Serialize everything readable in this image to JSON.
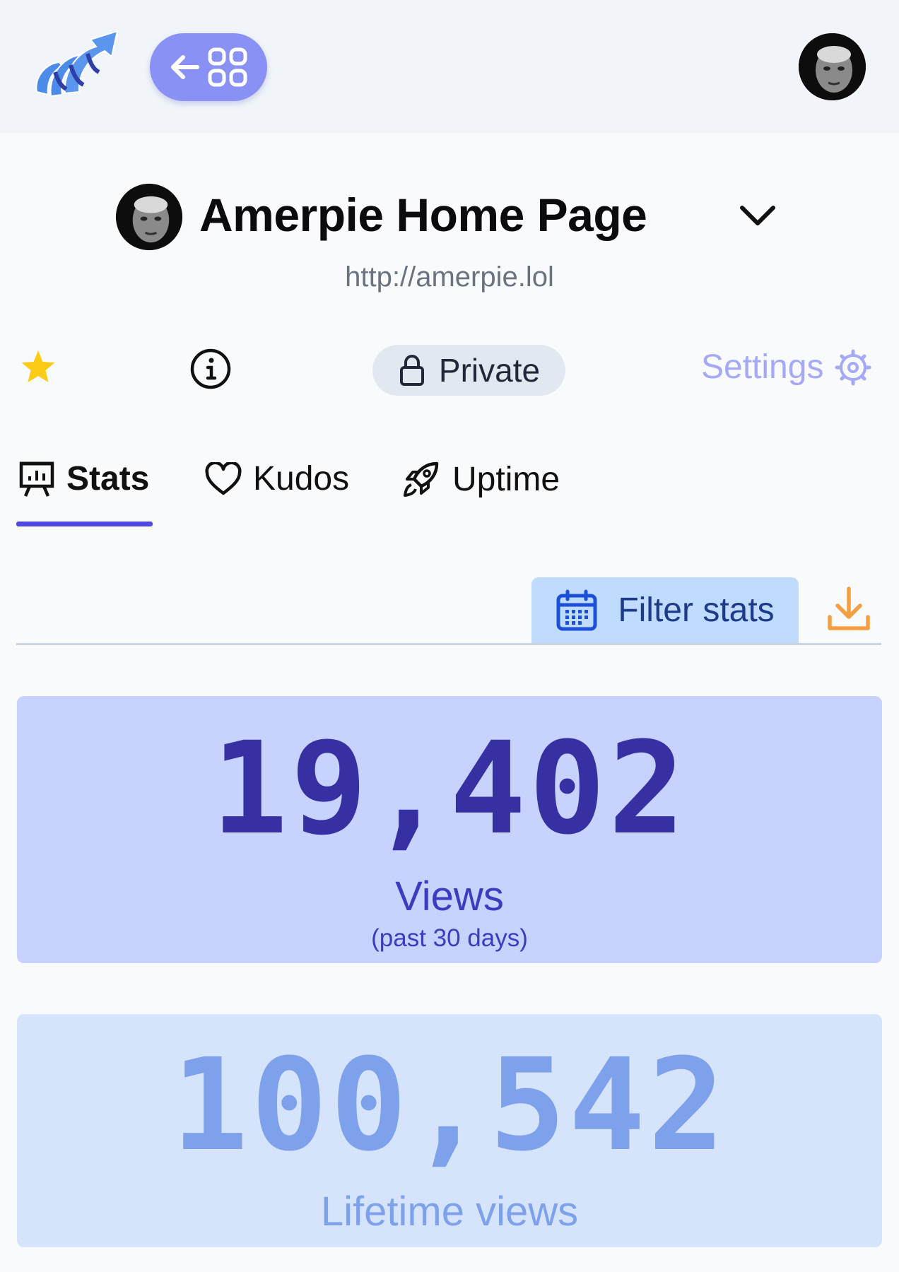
{
  "header": {
    "logo_icon": "omg-lol-logo-icon",
    "back_icon": "arrow-left-icon",
    "apps_icon": "grid-icon",
    "avatar_icon": "user-avatar"
  },
  "site": {
    "title": "Amerpie Home Page",
    "url": "http://amerpie.lol"
  },
  "actions": {
    "favorite_icon": "star-icon",
    "info_icon": "info-icon",
    "visibility_label": "Private",
    "settings_label": "Settings"
  },
  "tabs": [
    {
      "label": "Stats",
      "icon": "presentation-chart-icon",
      "active": true
    },
    {
      "label": "Kudos",
      "icon": "heart-icon",
      "active": false
    },
    {
      "label": "Uptime",
      "icon": "rocket-icon",
      "active": false
    }
  ],
  "filter": {
    "label": "Filter stats",
    "icon": "calendar-icon",
    "download_icon": "download-icon"
  },
  "stats": {
    "views": {
      "value": "19,402",
      "label": "Views",
      "period": "(past 30 days)"
    },
    "lifetime": {
      "value": "100,542",
      "label": "Lifetime views"
    }
  },
  "colors": {
    "accent": "#4f46e5",
    "progress": "#2f6df6",
    "star": "#facc15",
    "download": "#f59e42"
  },
  "progress_fraction": 0.15
}
